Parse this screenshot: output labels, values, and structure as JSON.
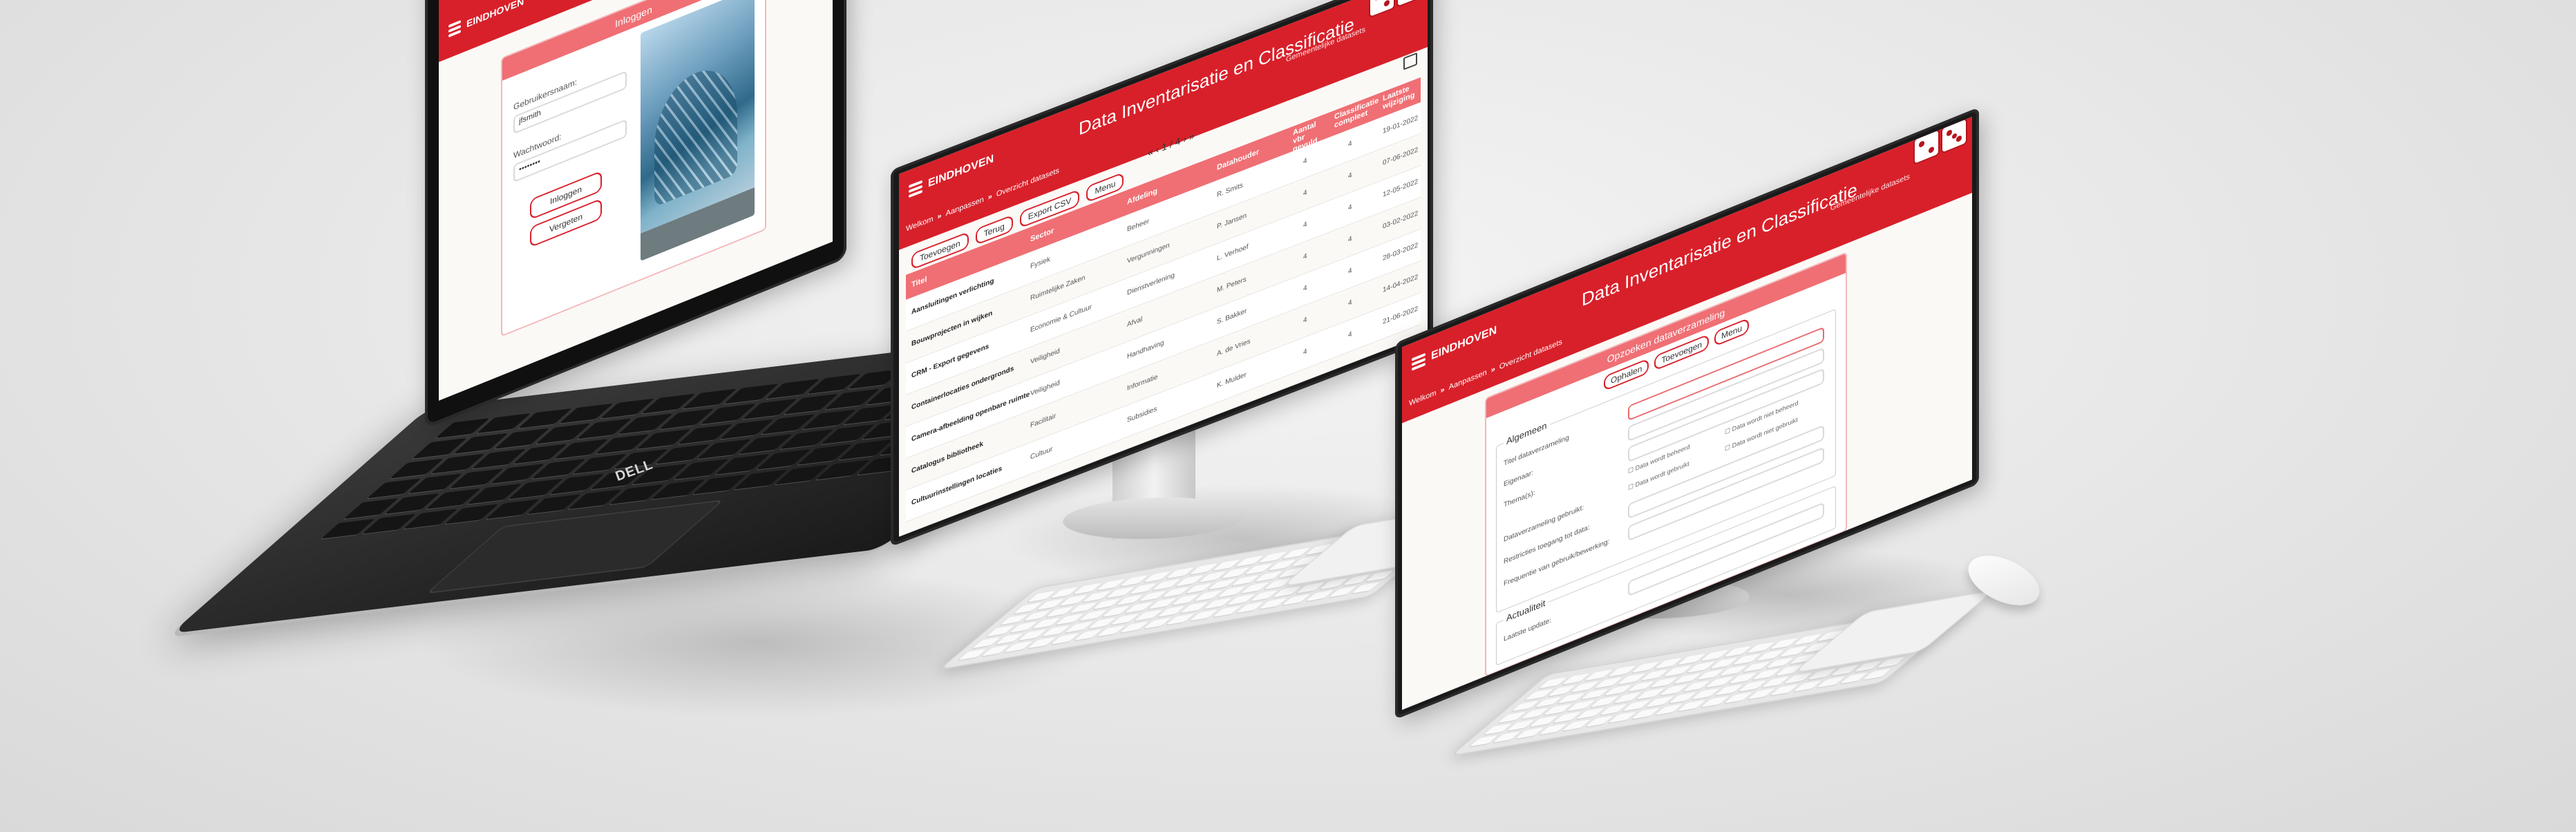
{
  "app": {
    "title": "Data Inventarisatie en Classificatie",
    "brand": "EINDHOVEN",
    "brand_color": "#d8202a",
    "accent_light": "#ef6f74"
  },
  "laptop": {
    "brand_label": "DELL",
    "login": {
      "panel_title": "Inloggen",
      "username_label": "Gebruikersnaam:",
      "username_value": "jfsmith",
      "password_label": "Wachtwoord:",
      "password_value": "••••••••",
      "login_button": "Inloggen",
      "forgot_button": "Vergeten"
    }
  },
  "monitor_left": {
    "nav_text": "Gemeentelijke datasets",
    "breadcrumb": [
      "Welkom",
      "Aanpassen",
      "Overzicht datasets"
    ],
    "toolbar": [
      "Toevoegen",
      "Terug",
      "Export CSV",
      "Menu"
    ],
    "pagination": "« ‹ 1 / 4 › »",
    "columns": [
      "Titel",
      "Sector",
      "Afdeling",
      "Datahouder",
      "Aantal vbr gevuld",
      "Classificatie compleet",
      "Laatste wijziging"
    ],
    "rows": [
      {
        "titel": "Aansluitingen verlichting",
        "sector": "Fysiek",
        "afdeling": "Beheer",
        "datahouder": "R. Smits",
        "aantal": "4",
        "classificatie": "4",
        "datum": "19-01-2022"
      },
      {
        "titel": "Bouwprojecten in wijken",
        "sector": "Ruimtelijke Zaken",
        "afdeling": "Vergunningen",
        "datahouder": "P. Jansen",
        "aantal": "4",
        "classificatie": "4",
        "datum": "07-06-2022"
      },
      {
        "titel": "CRM - Export gegevens",
        "sector": "Economie & Cultuur",
        "afdeling": "Dienstverlening",
        "datahouder": "L. Verhoef",
        "aantal": "4",
        "classificatie": "4",
        "datum": "12-05-2022"
      },
      {
        "titel": "Containerlocaties ondergronds",
        "sector": "Veiligheid",
        "afdeling": "Afval",
        "datahouder": "M. Peters",
        "aantal": "4",
        "classificatie": "4",
        "datum": "03-02-2022"
      },
      {
        "titel": "Camera-afbeelding openbare ruimte",
        "sector": "Veiligheid",
        "afdeling": "Handhaving",
        "datahouder": "S. Bakker",
        "aantal": "4",
        "classificatie": "4",
        "datum": "28-03-2022"
      },
      {
        "titel": "Catalogus bibliotheek",
        "sector": "Facilitair",
        "afdeling": "Informatie",
        "datahouder": "A. de Vries",
        "aantal": "4",
        "classificatie": "4",
        "datum": "14-04-2022"
      },
      {
        "titel": "Cultuurinstellingen locaties",
        "sector": "Cultuur",
        "afdeling": "Subsidies",
        "datahouder": "K. Mulder",
        "aantal": "4",
        "classificatie": "4",
        "datum": "21-06-2022"
      }
    ]
  },
  "monitor_right": {
    "nav_text": "Gemeentelijke datasets",
    "breadcrumb": [
      "Welkom",
      "Aanpassen",
      "Overzicht datasets"
    ],
    "panel_title": "Opzoeken dataverzameling",
    "toolbar": [
      "Ophalen",
      "Toevoegen",
      "Menu"
    ],
    "section_general": "Algemeen",
    "fields": [
      "Titel dataverzameling",
      "Eigenaar:",
      "Thema(s):",
      "Dataverzameling gebruikt:",
      "Restricties toegang tot data:",
      "Frequentie van gebruik/bewerking:"
    ],
    "checks": [
      "Data wordt beheerd",
      "Data wordt niet beheerd",
      "Data wordt gebruikt",
      "Data wordt niet gebruikt"
    ],
    "section_actuality": "Actualiteit",
    "actuality_field": "Laatste update:"
  }
}
